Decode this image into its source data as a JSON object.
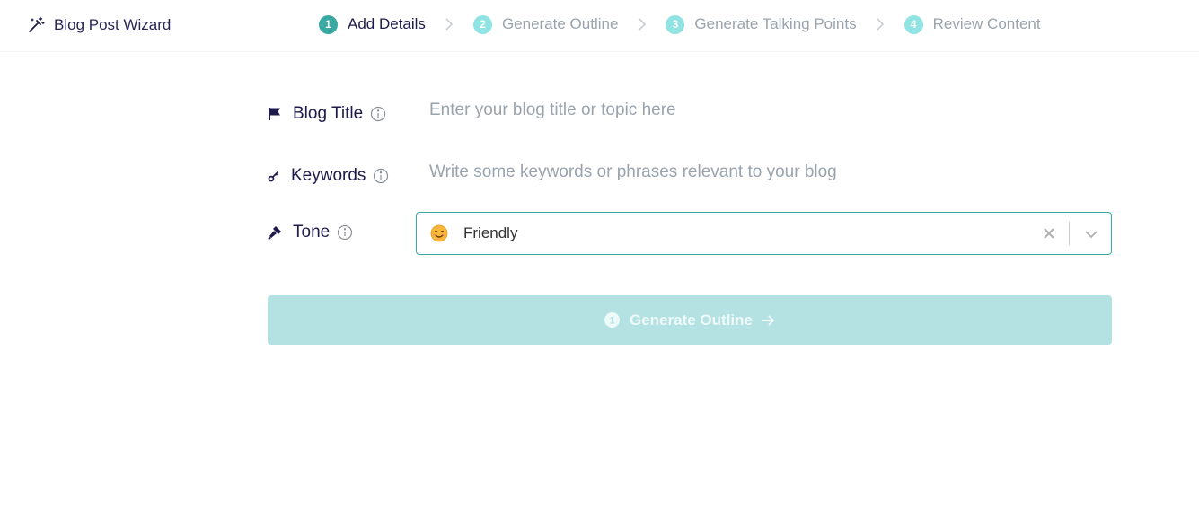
{
  "header": {
    "brand_title": "Blog Post Wizard",
    "brand_icon": "magic-wand-icon",
    "steps": [
      {
        "number": "1",
        "label": "Add Details",
        "state": "active"
      },
      {
        "number": "2",
        "label": "Generate Outline",
        "state": "inactive"
      },
      {
        "number": "3",
        "label": "Generate Talking Points",
        "state": "inactive"
      },
      {
        "number": "4",
        "label": "Review Content",
        "state": "inactive"
      }
    ]
  },
  "form": {
    "blog_title": {
      "label": "Blog Title",
      "icon": "flag-icon",
      "placeholder": "Enter your blog title or topic here",
      "value": ""
    },
    "keywords": {
      "label": "Keywords",
      "icon": "key-icon",
      "placeholder": "Write some keywords or phrases relevant to your blog",
      "value": ""
    },
    "tone": {
      "label": "Tone",
      "icon": "microphone-icon",
      "selected": "Friendly",
      "selected_icon": "smiling-face-emoji"
    }
  },
  "actions": {
    "generate_label": "Generate Outline",
    "generate_icon": "step-one-badge-icon",
    "generate_arrow": "arrow-right-icon",
    "generate_enabled": false
  },
  "colors": {
    "accent": "#3aa9a3",
    "step_inactive": "#8fe3e3",
    "button_disabled": "#b4e1e1",
    "text_primary": "#1e1b4b",
    "placeholder": "#9aa3ad"
  }
}
